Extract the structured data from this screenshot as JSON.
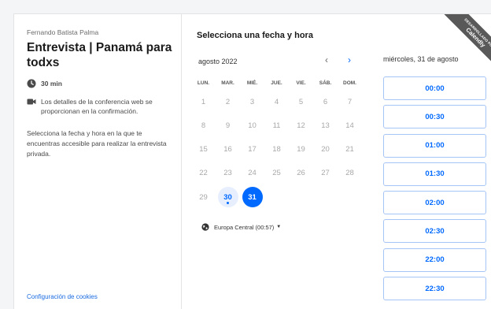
{
  "sidebar": {
    "organizer": "Fernando Batista Palma",
    "event_title": "Entrevista | Panamá para todxs",
    "duration": "30 min",
    "conference_note": "Los detalles de la conferencia web se proporcionan en la confirmación.",
    "description": "Selecciona la fecha y hora en la que te encuentras accesible para realizar la entrevista privada.",
    "cookie_settings": "Configuración de cookies"
  },
  "calendar": {
    "title": "Selecciona una fecha y hora",
    "month_label": "agosto 2022",
    "prev_icon": "‹",
    "next_icon": "›",
    "weekdays": [
      "LUN.",
      "MAR.",
      "MIÉ.",
      "JUE.",
      "VIE.",
      "SÁB.",
      "DOM."
    ],
    "days": [
      {
        "label": "1",
        "state": "disabled"
      },
      {
        "label": "2",
        "state": "disabled"
      },
      {
        "label": "3",
        "state": "disabled"
      },
      {
        "label": "4",
        "state": "disabled"
      },
      {
        "label": "5",
        "state": "disabled"
      },
      {
        "label": "6",
        "state": "disabled"
      },
      {
        "label": "7",
        "state": "disabled"
      },
      {
        "label": "8",
        "state": "disabled"
      },
      {
        "label": "9",
        "state": "disabled"
      },
      {
        "label": "10",
        "state": "disabled"
      },
      {
        "label": "11",
        "state": "disabled"
      },
      {
        "label": "12",
        "state": "disabled"
      },
      {
        "label": "13",
        "state": "disabled"
      },
      {
        "label": "14",
        "state": "disabled"
      },
      {
        "label": "15",
        "state": "disabled"
      },
      {
        "label": "16",
        "state": "disabled"
      },
      {
        "label": "17",
        "state": "disabled"
      },
      {
        "label": "18",
        "state": "disabled"
      },
      {
        "label": "19",
        "state": "disabled"
      },
      {
        "label": "20",
        "state": "disabled"
      },
      {
        "label": "21",
        "state": "disabled"
      },
      {
        "label": "22",
        "state": "disabled"
      },
      {
        "label": "23",
        "state": "disabled"
      },
      {
        "label": "24",
        "state": "disabled"
      },
      {
        "label": "25",
        "state": "disabled"
      },
      {
        "label": "26",
        "state": "disabled"
      },
      {
        "label": "27",
        "state": "disabled"
      },
      {
        "label": "28",
        "state": "disabled"
      },
      {
        "label": "29",
        "state": "disabled"
      },
      {
        "label": "30",
        "state": "available"
      },
      {
        "label": "31",
        "state": "selected"
      }
    ],
    "timezone": "Europa Central (00:57)",
    "timezone_caret": "▼"
  },
  "slots": {
    "date_label": "miércoles, 31 de agosto",
    "times": [
      "00:00",
      "00:30",
      "01:00",
      "01:30",
      "02:00",
      "02:30",
      "22:00",
      "22:30"
    ]
  },
  "badge": {
    "small_text": "DESARROLLADO POR",
    "brand_text": "Calendly"
  },
  "colors": {
    "accent": "#0069ff",
    "available_bg": "#e7efff",
    "ribbon": "#595959"
  }
}
